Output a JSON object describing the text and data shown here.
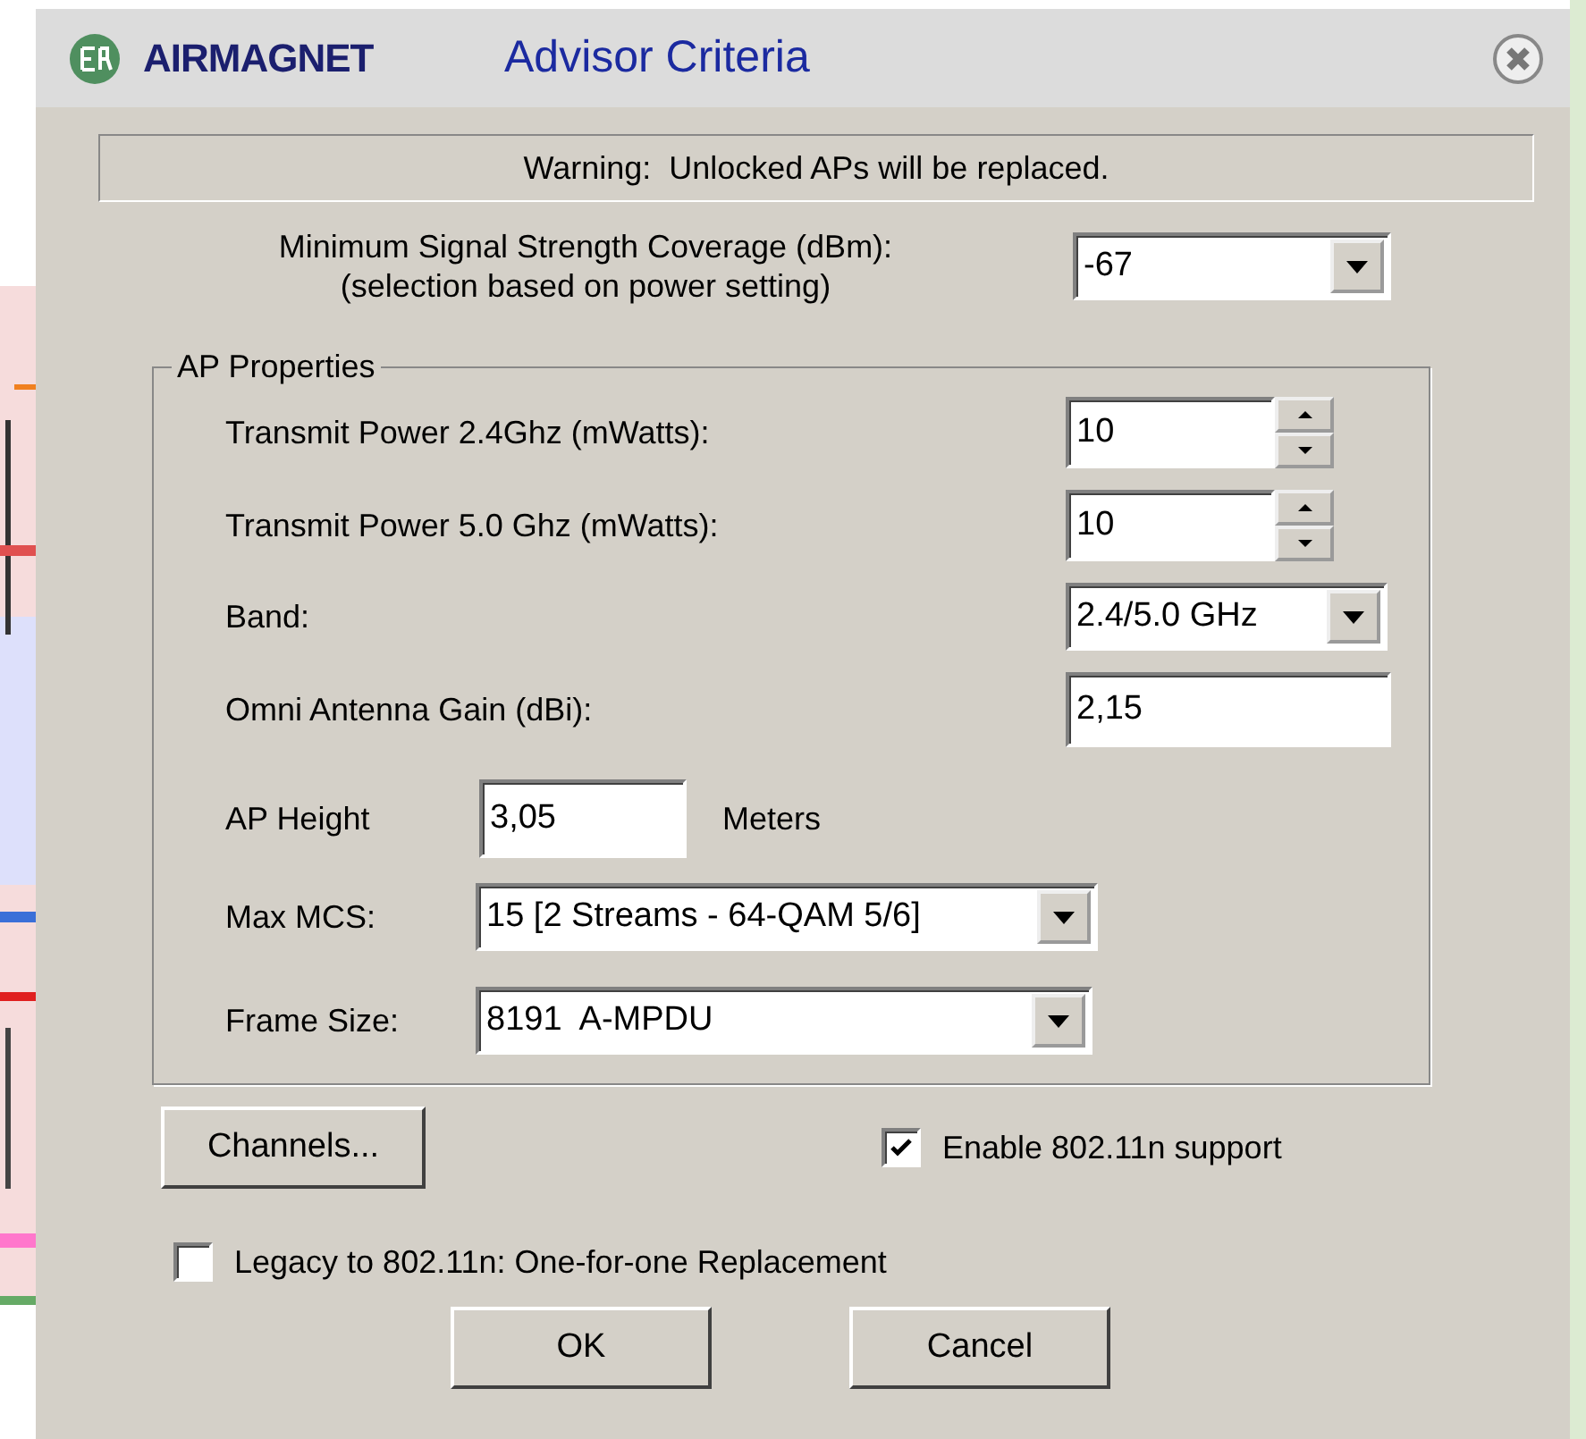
{
  "window": {
    "brand": "AIRMAGNET",
    "title": "Advisor Criteria"
  },
  "warning": "Warning:  Unlocked APs will be replaced.",
  "min_signal": {
    "label": "Minimum Signal Strength Coverage (dBm):",
    "note": "(selection based on power setting)",
    "value": "-67"
  },
  "group": {
    "legend": "AP Properties",
    "fields": [
      {
        "kind": "spinner",
        "label": "Transmit Power 2.4Ghz (mWatts):",
        "value": "10"
      },
      {
        "kind": "spinner",
        "label": "Transmit Power 5.0 Ghz (mWatts):",
        "value": "10"
      },
      {
        "kind": "combo",
        "label": "Band:",
        "value": "2.4/5.0 GHz"
      },
      {
        "kind": "text",
        "label": "Omni Antenna Gain (dBi):",
        "value": "2,15"
      }
    ],
    "height": {
      "label": "AP Height",
      "value": "3,05",
      "unit": "Meters"
    },
    "max_mcs": {
      "label": "Max MCS:",
      "value": "15 [2 Streams - 64-QAM 5/6]"
    },
    "frame_size": {
      "label": "Frame Size:",
      "value": "8191  A-MPDU"
    }
  },
  "channels_button": "Channels...",
  "enable_11n": {
    "label": "Enable 802.11n support",
    "checked": true
  },
  "legacy": {
    "label": "Legacy to 802.11n: One-for-one Replacement",
    "checked": false
  },
  "buttons": [
    "OK",
    "Cancel"
  ]
}
